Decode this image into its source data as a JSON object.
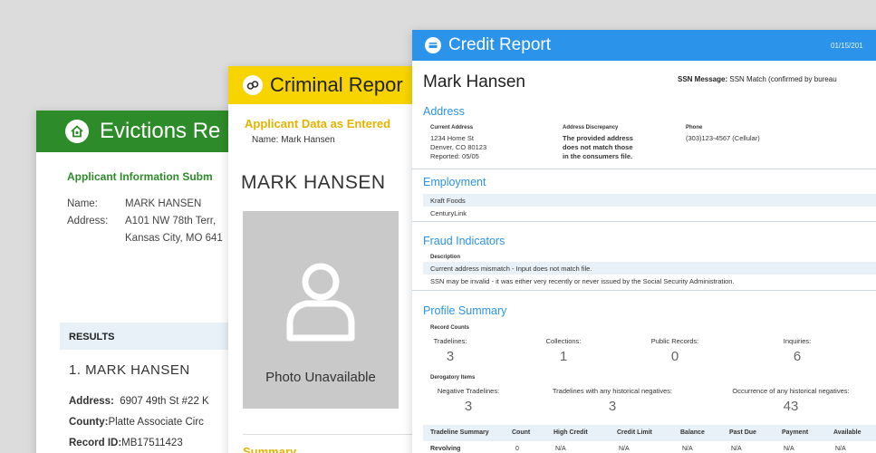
{
  "colors": {
    "evictions": "#2e8b2a",
    "criminal": "#f7d400",
    "credit": "#2b93ea"
  },
  "evictions": {
    "title": "Evictions Re",
    "icon": "house-icon",
    "subheader": "Applicant Information Subm",
    "name_label": "Name:",
    "name_value": "MARK HANSEN",
    "address_label": "Address:",
    "address_line1": "A101 NW 78th Terr,",
    "address_line2": "Kansas City, MO 641",
    "results_label": "RESULTS",
    "result_name": "1. MARK HANSEN",
    "address_k": "Address:",
    "address_v": "6907 49th St #22 K",
    "county_k": "County:",
    "county_v": "Platte Associate Circ",
    "record_k": "Record ID:",
    "record_v": "MB17511423"
  },
  "criminal": {
    "title": "Criminal Repor",
    "icon": "handcuffs-icon",
    "subheader": "Applicant Data as Entered",
    "name_line": "Name: Mark Hansen",
    "big_name": "MARK HANSEN",
    "photo_text": "Photo Unavailable",
    "summary": "Summary"
  },
  "credit": {
    "title": "Credit Report",
    "icon": "credit-icon",
    "date": "01/15/201",
    "name": "Mark Hansen",
    "ssn_label": "SSN Message:",
    "ssn_value": "SSN Match (confirmed by bureau",
    "address_title": "Address",
    "current_address_label": "Current Address",
    "current_address": "1234 Home St\nDenver, CO 80123\nReported: 05/05",
    "discrepancy_label": "Address Discrepancy",
    "discrepancy_text": "The provided address\ndoes not match those\nin the consumers file.",
    "phone_label": "Phone",
    "phone_value": "(303)123-4567 (Cellular)",
    "employment_title": "Employment",
    "employers": [
      "Kraft Foods",
      "CenturyLink"
    ],
    "fraud_title": "Fraud Indicators",
    "fraud_desc_label": "Description",
    "fraud_items": [
      "Current address mismatch - Input does not match file.",
      "SSN may be invalid - it was either very recently or never issued by the Social Security Administration."
    ],
    "profile_title": "Profile Summary",
    "record_counts_label": "Record Counts",
    "counts": [
      {
        "label": "Tradelines:",
        "value": "3"
      },
      {
        "label": "Collections:",
        "value": "1"
      },
      {
        "label": "Public Records:",
        "value": "0"
      },
      {
        "label": "Inquiries:",
        "value": "6"
      }
    ],
    "derog_label": "Derogatory Items",
    "derog": [
      {
        "label": "Negative Tradelines:",
        "value": "3"
      },
      {
        "label": "Tradelines with any historical negatives:",
        "value": "3"
      },
      {
        "label": "Occurrence of any historical negatives:",
        "value": "43"
      }
    ],
    "table_headers": [
      "Tradeline Summary",
      "Count",
      "High Credit",
      "Credit Limit",
      "Balance",
      "Past Due",
      "Payment",
      "Available"
    ],
    "table_row": [
      "Revolving",
      "0",
      "N/A",
      "N/A",
      "N/A",
      "N/A",
      "N/A",
      "N/A"
    ]
  }
}
